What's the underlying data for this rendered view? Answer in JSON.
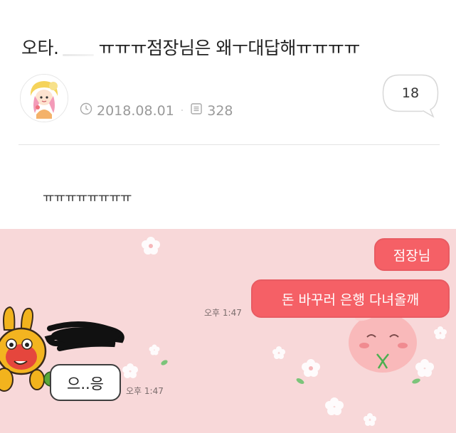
{
  "post": {
    "title_prefix": "오타.",
    "title_suffix": "ㅠㅠㅠ점장님은 왜ㅜ대답해ㅠㅠㅠㅠ",
    "date": "2018.08.01",
    "views": "328",
    "comment_count": "18",
    "body": "ㅠㅠㅠㅠㅠㅠㅠㅠ"
  },
  "chat": {
    "outgoing": [
      "점장님",
      "돈 바꾸러 은행 다녀올깨"
    ],
    "outgoing_time": "오후 1:47",
    "incoming": "으..응",
    "incoming_time": "오후 1:47"
  },
  "icons": {
    "date": "clock-icon",
    "views": "list-icon",
    "comments": "speech-bubble-icon"
  },
  "colors": {
    "chat_background": "#f8d8d9",
    "outgoing_bubble": "#f56066"
  }
}
